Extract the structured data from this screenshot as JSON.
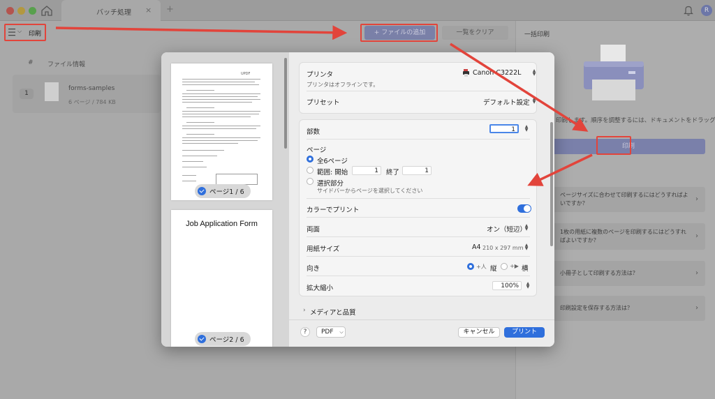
{
  "window": {
    "tab_title": "バッチ処理",
    "tab_close": "×",
    "tab_add": "+",
    "avatar_initial": "R"
  },
  "toolbar": {
    "menu_chevron": "⌵",
    "print_label": "印刷",
    "add_file": "+ ファイルの追加",
    "clear_list": "一覧をクリア",
    "batch_print": "一括印刷"
  },
  "file_list": {
    "col_number": "#",
    "col_info": "ファイル情報",
    "rows": [
      {
        "number": "1",
        "name": "forms-samples",
        "meta": "6 ページ  /  784 KB"
      }
    ]
  },
  "right_panel": {
    "drop_hint": "印刷します。順序を調整するには、ドキュメントをドラッグ",
    "print_button": "印刷",
    "faq": [
      {
        "text": "ページサイズに合わせて印刷するにはどうすればよいですか？"
      },
      {
        "text": "1枚の用紙に複数のページを印刷するにはどうすればよいですか？"
      },
      {
        "text": "小冊子として印刷する方法は？"
      },
      {
        "text": "印刷設定を保存する方法は？"
      }
    ],
    "chevron": "›"
  },
  "print_dialog": {
    "preview": {
      "page1_badge": "ページ1 / 6",
      "page1_brand": "UPDF",
      "page2_badge": "ページ2 / 6",
      "page2_title": "Job Application Form"
    },
    "printer": {
      "label": "プリンタ",
      "value": "Canon C3222L",
      "status": "プリンタはオフラインです。"
    },
    "preset": {
      "label": "プリセット",
      "value": "デフォルト設定"
    },
    "copies": {
      "label": "部数",
      "value": "1"
    },
    "pages": {
      "label": "ページ",
      "all": "全6ページ",
      "range_label": "範囲: 開始",
      "range_from": "1",
      "range_to_label": "終了",
      "range_to": "1",
      "selection": "選択部分",
      "selection_hint": "サイドバーからページを選択してください"
    },
    "color": {
      "label": "カラーでプリント",
      "enabled": true
    },
    "duplex": {
      "label": "両面",
      "value": "オン（短辺）"
    },
    "paper": {
      "label": "用紙サイズ",
      "value": "A4",
      "dims": "210 x 297 mm"
    },
    "orientation": {
      "label": "向き",
      "portrait": "縦",
      "landscape": "横",
      "portrait_icon": "+人",
      "landscape_icon": "+▶"
    },
    "scale": {
      "label": "拡大縮小",
      "value": "100%"
    },
    "media": {
      "label": "メディアと品質",
      "chevron": "›"
    },
    "footer": {
      "help": "?",
      "pdf": "PDF",
      "pdf_chevron": "⌵",
      "cancel": "キャンセル",
      "print": "プリント"
    }
  },
  "colors": {
    "accent": "#2f6fdc",
    "annotation": "#e2443b"
  }
}
